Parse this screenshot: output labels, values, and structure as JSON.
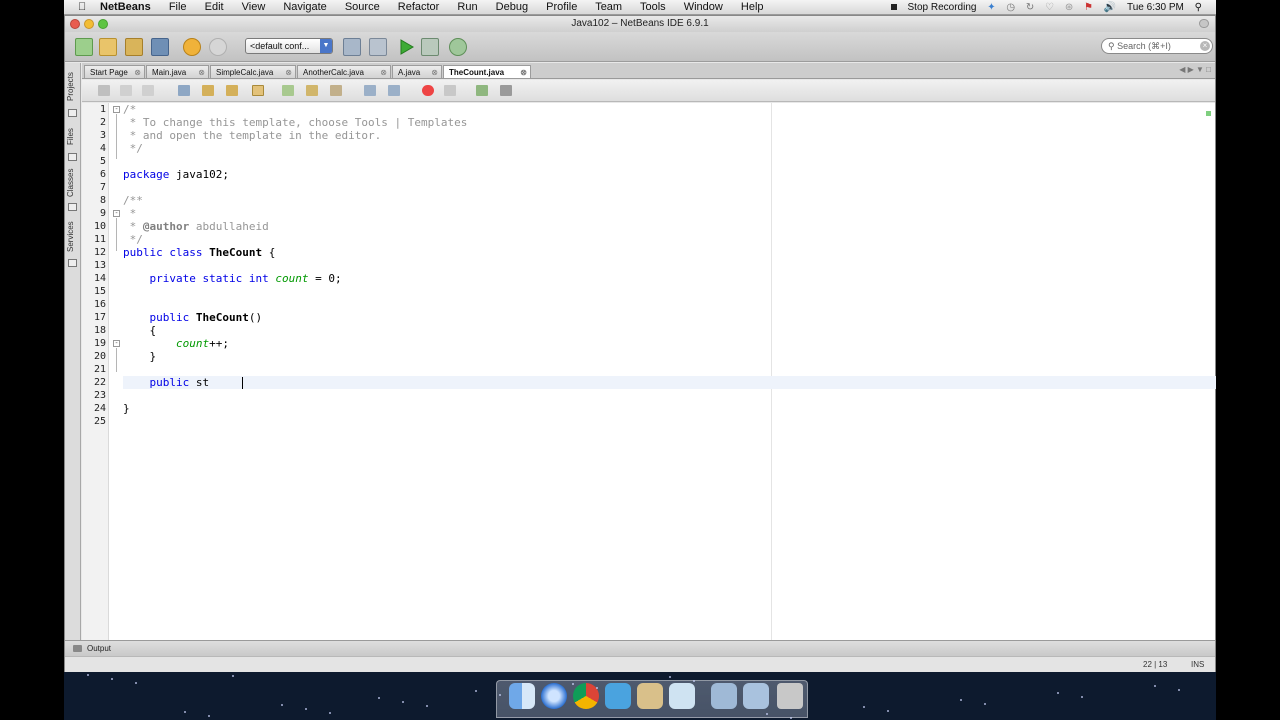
{
  "menubar": {
    "app_name": "NetBeans",
    "menus": [
      "File",
      "Edit",
      "View",
      "Navigate",
      "Source",
      "Refactor",
      "Run",
      "Debug",
      "Profile",
      "Team",
      "Tools",
      "Window",
      "Help"
    ],
    "stop_recording": "Stop Recording",
    "clock": "Tue 6:30 PM"
  },
  "window": {
    "title": "Java102 – NetBeans IDE 6.9.1"
  },
  "toolbar": {
    "config_value": "<default conf...",
    "search_placeholder": "Search (⌘+I)"
  },
  "side_tabs": [
    "Projects",
    "Files",
    "Classes",
    "Services"
  ],
  "tabs": [
    {
      "label": "Start Page"
    },
    {
      "label": "Main.java"
    },
    {
      "label": "SimpleCalc.java"
    },
    {
      "label": "AnotherCalc.java"
    },
    {
      "label": "A.java"
    },
    {
      "label": "TheCount.java"
    }
  ],
  "editor": {
    "line_numbers": [
      "1",
      "2",
      "3",
      "4",
      "5",
      "6",
      "7",
      "8",
      "9",
      "10",
      "11",
      "12",
      "13",
      "14",
      "15",
      "16",
      "17",
      "18",
      "19",
      "20",
      "21",
      "22",
      "23",
      "24",
      "25"
    ],
    "code": {
      "l1": "/*",
      "l2": " * To change this template, choose Tools | Templates",
      "l3": " * and open the template in the editor.",
      "l4": " */",
      "l6_kw": "package",
      "l6_rest": " java102;",
      "l8": "/**",
      "l9": " *",
      "l10_star": " * ",
      "l10_tag": "@author",
      "l10_rest": " abdullaheid",
      "l11": " */",
      "l12_kw": "public class",
      "l12_name": "TheCount",
      "l12_rest": " {",
      "l14_kw": "private static int",
      "l14_field": "count",
      "l14_rest": " = 0;",
      "l17_kw": "public",
      "l17_name": "TheCount",
      "l17_rest": "()",
      "l18": "{",
      "l19_field": "count",
      "l19_rest": "++;",
      "l20": "}",
      "l22_kw": "public",
      "l22_rest": " st",
      "l24": "}"
    }
  },
  "output_tab": "Output",
  "status": {
    "position": "22 | 13",
    "mode": "INS"
  }
}
